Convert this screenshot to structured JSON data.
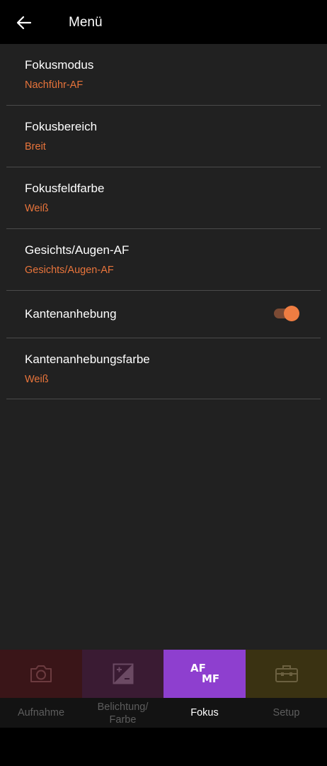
{
  "header": {
    "title": "Menü"
  },
  "menu": {
    "items": [
      {
        "label": "Fokusmodus",
        "value": "Nachführ-AF"
      },
      {
        "label": "Fokusbereich",
        "value": "Breit"
      },
      {
        "label": "Fokusfeldfarbe",
        "value": "Weiß"
      },
      {
        "label": "Gesichts/Augen-AF",
        "value": "Gesichts/Augen-AF"
      },
      {
        "label": "Kantenanhebung",
        "toggle_on": true
      },
      {
        "label": "Kantenanhebungsfarbe",
        "value": "Weiß"
      }
    ]
  },
  "bottom_nav": {
    "tabs": [
      {
        "label": "Aufnahme",
        "icon": "camera-icon",
        "color": "#3a1518"
      },
      {
        "label_line1": "Belichtung/",
        "label_line2": "Farbe",
        "icon": "exposure-compensation-icon",
        "color": "#3a1b33"
      },
      {
        "label": "Fokus",
        "icon": "af-mf-icon",
        "icon_text_top": "AF",
        "icon_text_bottom": "MF",
        "color": "#8e3fcf",
        "active": true
      },
      {
        "label": "Setup",
        "icon": "toolbox-icon",
        "color": "#3a3212"
      }
    ]
  },
  "colors": {
    "accent": "#e8743b",
    "background": "#212121",
    "divider": "#4a4a4a"
  }
}
